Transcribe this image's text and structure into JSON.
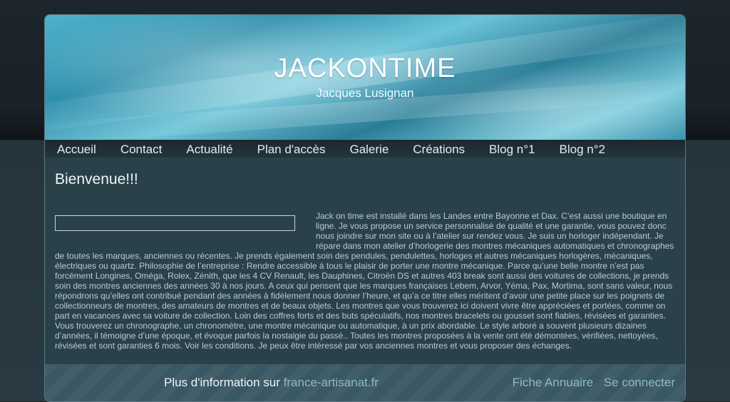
{
  "header": {
    "title": "JACKONTIME",
    "subtitle": "Jacques Lusignan"
  },
  "nav": {
    "items": [
      {
        "label": "Accueil"
      },
      {
        "label": "Contact"
      },
      {
        "label": "Actualité"
      },
      {
        "label": "Plan d'accès"
      },
      {
        "label": "Galerie"
      },
      {
        "label": "Créations"
      },
      {
        "label": "Blog n°1"
      },
      {
        "label": "Blog n°2"
      }
    ]
  },
  "main": {
    "title": "Bienvenue!!!",
    "body": "Jack on time est installé dans les Landes entre Bayonne et Dax. C’est aussi une boutique en ligne. Je vous propose un service personnalisé de qualité et une garantie, vous pouvez donc nous joindre sur mon site ou à l’atelier sur rendez vous. Je suis un horloger indépendant. Je répare dans mon atelier d’horlogerie des montres mécaniques automatiques et chronographes de toutes les marques, anciennes ou récentes. Je prends également soin des pendules, pendulettes, horloges et autres mécaniques horlogères, mécaniques, électriques ou quartz. Philosophie de l’entreprise : Rendre accessible à tous le plaisir de porter une montre mécanique. Parce qu’une belle montre n’est pas forcément Longines, Oméga, Rolex, Zénith, que les 4 CV Renault, les Dauphines, Citroën DS et autres 403 break sont aussi des voitures de collections, je prends soin des montres anciennes des années 30 à nos jours. A ceux qui pensent que les marques françaises Lebem, Arvor, Yéma, Pax, Mortima, sont sans valeur, nous répondrons qu’elles ont contribué pendant des années à fidèlement nous donner l’heure, et qu’a ce titre elles méritent d’avoir une petite place sur les poignets de collectionneurs de montres, des amateurs de montres et de beaux objets. Les montres que vous trouverez ici doivent vivre être appréciées et portées, comme on part en vacances avec sa voiture de collection. Loin des coffres forts et des buts spéculatifs, nos montres bracelets ou gousset sont fiables, révisées et garanties. Vous trouverez un chronographe, un chronomètre, une montre mécanique ou automatique, à un prix abordable. Le style arboré a souvent plusieurs dizaines d’années, il témoigne d’une époque, et évoque parfois la nostalgie du passé.. Toutes les montres proposées à la vente ont été démontées, vérifiées, nettoyées, révisées et sont garanties 6 mois. Voir les conditions. Je peux être intéressé par vos anciennes montres et vous proposer des échanges."
  },
  "footer": {
    "prefix": "Plus d'information sur ",
    "site_link": "france-artisanat.fr",
    "fiche_link": "Fiche Annuaire",
    "login_link": "Se connecter"
  }
}
